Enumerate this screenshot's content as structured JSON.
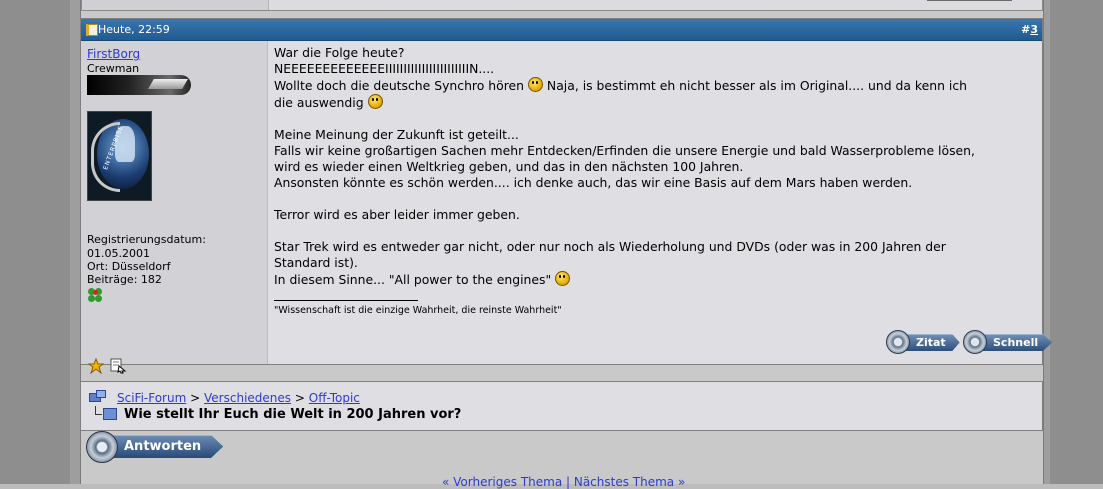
{
  "post": {
    "date": "Heute, 22:59",
    "number_prefix": "#",
    "number": "3",
    "user": {
      "name": "FirstBorg",
      "title": "Crewman",
      "avatar_text": "ENTERPRISE",
      "reg_label": "Registrierungsdatum:",
      "reg_date": "01.05.2001",
      "location": "Ort: Düsseldorf",
      "posts": "Beiträge: 182"
    },
    "message": {
      "l1": "War die Folge heute?",
      "l2": "NEEEEEEEEEEEEEIIIIIIIIIIIIIIIIIIIIIIIN....",
      "l3a": "Wollte doch die deutsche Synchro hören",
      "l3b": "Naja, is bestimmt eh nicht besser als im Original.... und da kenn ich",
      "l4": "die auswendig",
      "l6": "Meine Meinung der Zukunft ist geteilt...",
      "l7": "Falls wir keine großartigen Sachen mehr Entdecken/Erfinden die unsere Energie und bald Wasserprobleme lösen,",
      "l8": "wird es wieder einen Weltkrieg geben, und das in den nächsten 100 Jahren.",
      "l9": "Ansonsten könnte es schön werden.... ich denke auch, das wir eine Basis auf dem Mars haben werden.",
      "l11": "Terror wird es aber leider immer geben.",
      "l13": "Star Trek wird es entweder gar nicht, oder nur noch als Wiederholung und DVDs (oder was in 200 Jahren der",
      "l14": "Standard ist).",
      "l15": "In diesem Sinne... \"All power to the engines\""
    },
    "signature": "\"Wissenschaft ist die einzige Wahrheit, die reinste Wahrheit\"",
    "quote_label": "Zitat",
    "quick_label": "Schnell"
  },
  "nav": {
    "crumb1": "SciFi-Forum",
    "sep": ">",
    "crumb2": "Verschiedenes",
    "crumb3": "Off-Topic",
    "thread_title": "Wie stellt Ihr Euch die Welt in 200 Jahren vor?"
  },
  "reply_label": "Antworten",
  "bottom": {
    "text": "« Vorheriges Thema | Nächstes Thema »"
  }
}
